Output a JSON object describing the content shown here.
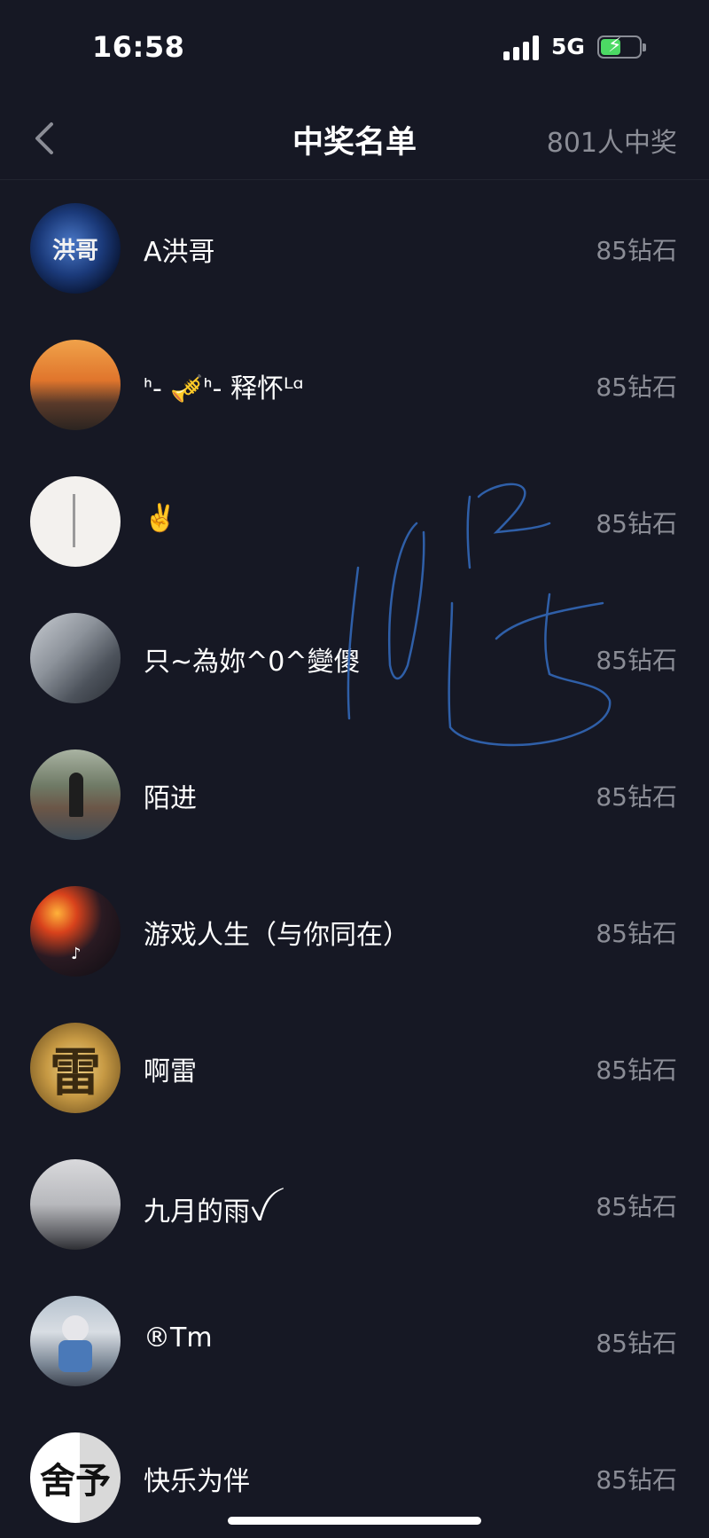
{
  "status_bar": {
    "time": "16:58",
    "network": "5G"
  },
  "header": {
    "title": "中奖名单",
    "count_label": "801人中奖"
  },
  "winners": [
    {
      "name": "A洪哥",
      "prize": "85钻石",
      "avatar_text": "洪哥"
    },
    {
      "name": "ᑋ- 🎺ᑋ- 释怀ᴸᵅ",
      "prize": "85钻石",
      "avatar_text": ""
    },
    {
      "name": "✌️",
      "prize": "85钻石",
      "avatar_text": ""
    },
    {
      "name": "只~為妳^0^變傻",
      "prize": "85钻石",
      "avatar_text": ""
    },
    {
      "name": "陌进",
      "prize": "85钻石",
      "avatar_text": ""
    },
    {
      "name": "游戏人生（与你同在）",
      "prize": "85钻石",
      "avatar_text": ""
    },
    {
      "name": "啊雷",
      "prize": "85钻石",
      "avatar_text": "雷"
    },
    {
      "name": "九月的雨ꪜ",
      "prize": "85钻石",
      "avatar_text": ""
    },
    {
      "name": "®Tm",
      "prize": "85钻石",
      "avatar_text": ""
    },
    {
      "name": "快乐为伴",
      "prize": "85钻石",
      "avatar_text": "舍予"
    }
  ],
  "colors": {
    "background": "#161824",
    "secondary_text": "#8b8d96",
    "battery_fill": "#4cd964",
    "scribble": "#2f5fa8"
  },
  "icons": {
    "back": "chevron-left-icon",
    "signal": "signal-bars-icon",
    "battery": "battery-charging-icon"
  }
}
